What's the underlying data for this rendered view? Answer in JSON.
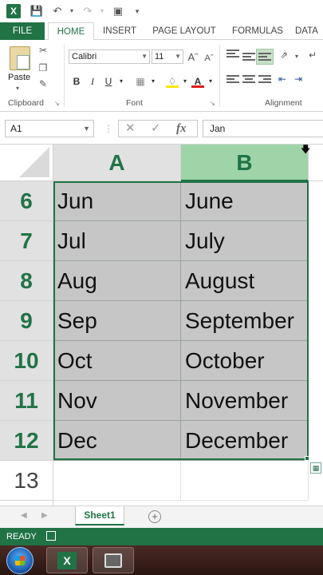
{
  "app": {
    "logo_letter": "X",
    "accent_color": "#217346"
  },
  "ribbon_tabs": [
    "FILE",
    "HOME",
    "INSERT",
    "PAGE LAYOUT",
    "FORMULAS",
    "DATA"
  ],
  "ribbon": {
    "clipboard": {
      "paste_label": "Paste",
      "group_label": "Clipboard"
    },
    "font": {
      "font_name": "Calibri",
      "font_size": "11",
      "bold": "B",
      "italic": "I",
      "underline": "U",
      "group_label": "Font"
    },
    "alignment": {
      "group_label": "Alignment"
    }
  },
  "formula_bar": {
    "name_box": "A1",
    "fx_label": "fx",
    "value": "Jan"
  },
  "grid": {
    "columns": [
      "A",
      "B"
    ],
    "rows": [
      {
        "num": "6",
        "a": "Jun",
        "b": "June"
      },
      {
        "num": "7",
        "a": "Jul",
        "b": "July"
      },
      {
        "num": "8",
        "a": "Aug",
        "b": "August"
      },
      {
        "num": "9",
        "a": "Sep",
        "b": "September"
      },
      {
        "num": "10",
        "a": "Oct",
        "b": "October"
      },
      {
        "num": "11",
        "a": "Nov",
        "b": "November"
      },
      {
        "num": "12",
        "a": "Dec",
        "b": "December"
      },
      {
        "num": "13",
        "a": "",
        "b": ""
      }
    ]
  },
  "sheets": [
    "Sheet1"
  ],
  "status": {
    "text": "READY"
  }
}
